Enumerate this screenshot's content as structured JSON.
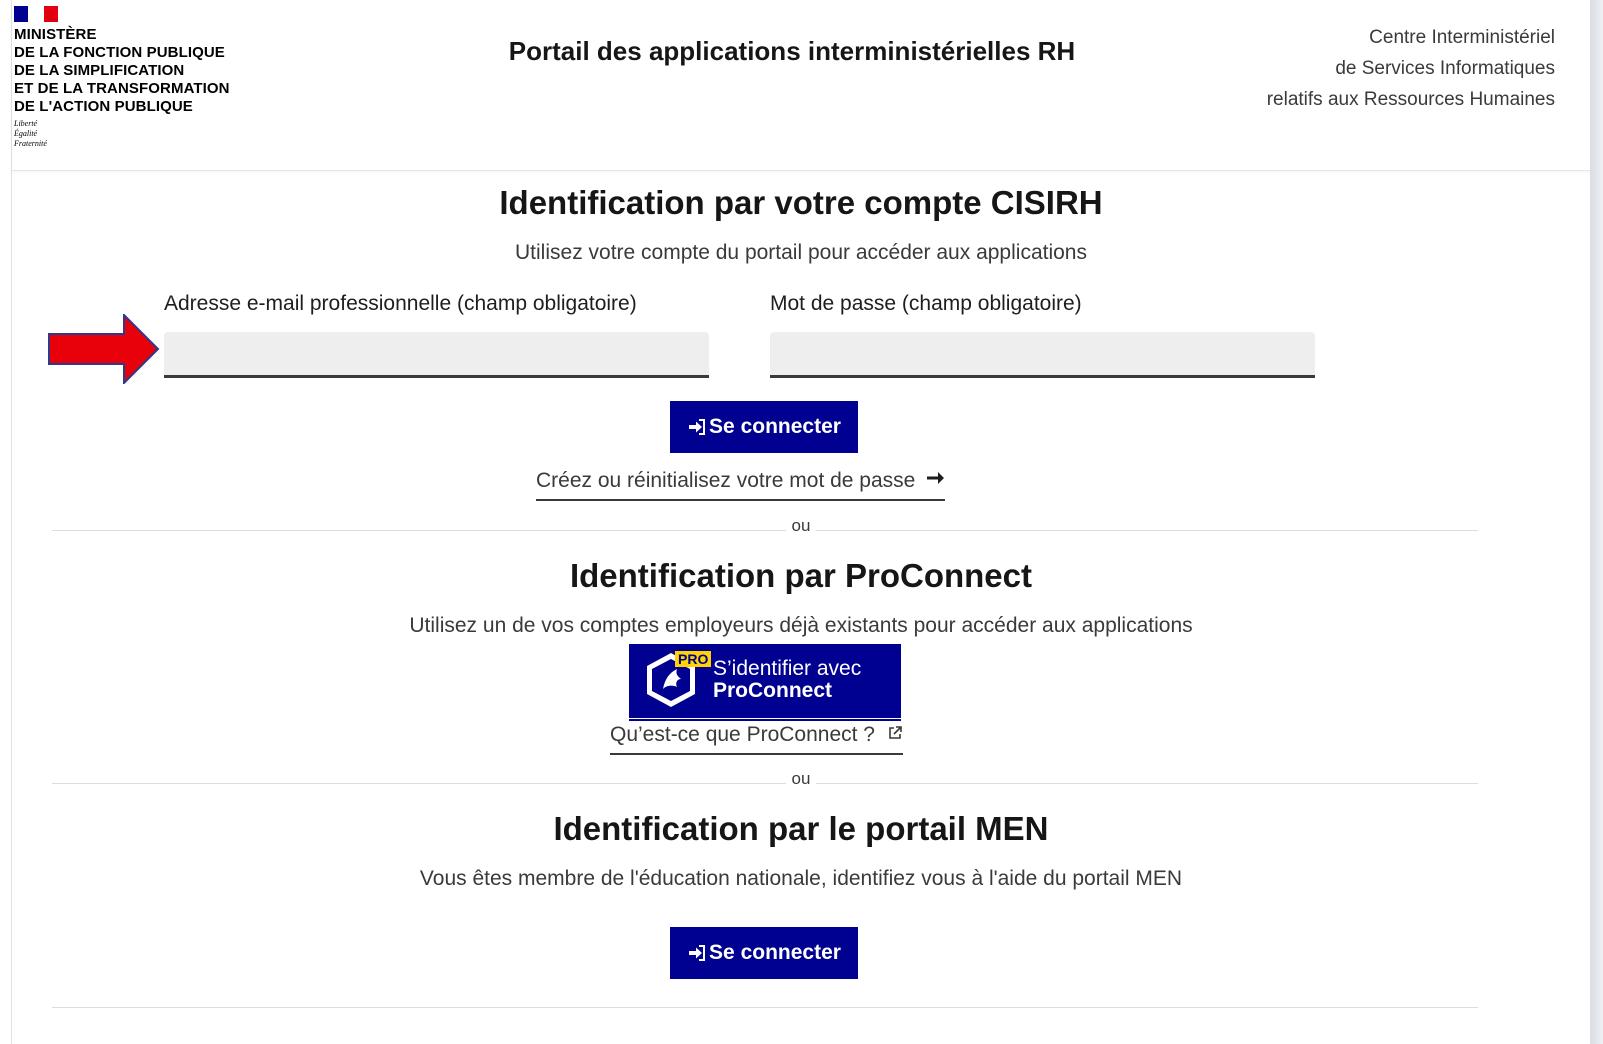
{
  "header": {
    "ministry_lines": [
      "MINISTÈRE",
      "DE LA FONCTION PUBLIQUE",
      "DE LA SIMPLIFICATION",
      "ET DE LA TRANSFORMATION",
      "DE L'ACTION PUBLIQUE"
    ],
    "motto": [
      "Liberté",
      "Égalité",
      "Fraternité"
    ],
    "title": "Portail des applications interministérielles RH",
    "org_lines": [
      "Centre Interministériel",
      "de Services Informatiques",
      "relatifs aux Ressources Humaines"
    ]
  },
  "cisirh": {
    "title": "Identification par votre compte CISIRH",
    "subtitle": "Utilisez votre compte du portail pour accéder aux applications",
    "email_label": "Adresse e-mail professionnelle (champ obligatoire)",
    "email_value": "",
    "password_label": "Mot de passe (champ obligatoire)",
    "password_value": "",
    "login_button": "Se connecter",
    "reset_link": "Créez ou réinitialisez votre mot de passe"
  },
  "separator_1": "ou",
  "proconnect": {
    "title": "Identification par ProConnect",
    "subtitle": "Utilisez un de vos comptes employeurs déjà existants pour accéder aux applications",
    "badge": "PRO",
    "button_line1": "S’identifier avec",
    "button_line2": "ProConnect",
    "info_link": "Qu’est-ce que ProConnect ?"
  },
  "separator_2": "ou",
  "men": {
    "title": "Identification par le portail MEN",
    "subtitle": "Vous êtes membre de l'éducation nationale, identifiez vous à l'aide du portail MEN",
    "login_button": "Se connecter"
  },
  "colors": {
    "primary": "#000091",
    "annotation_arrow": "#e8000b",
    "flag_blue": "#000091",
    "flag_red": "#e1000f"
  },
  "icons": {
    "login": "sign-in-icon",
    "arrow_right": "arrow-right-icon",
    "external": "external-link-icon",
    "annotation": "red-arrow-icon"
  }
}
